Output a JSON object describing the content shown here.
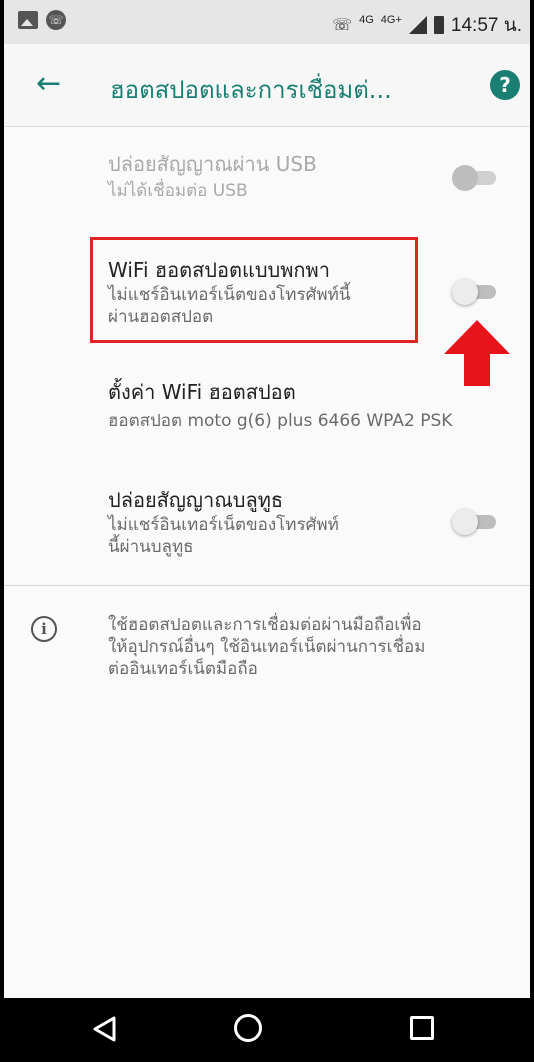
{
  "status_bar": {
    "network_small": "4G",
    "network": "4G+",
    "time": "14:57 น."
  },
  "toolbar": {
    "title": "ฮอตสปอตและการเชื่อมต่...",
    "help_label": "?"
  },
  "items": [
    {
      "title": "ปล่อยสัญญาณผ่าน USB",
      "subtitle": "ไม่ได้เชื่อมต่อ USB",
      "switch_on": false,
      "enabled": false
    },
    {
      "title": "WiFi ฮอตสปอตแบบพกพา",
      "subtitle": "ไม่แชร์อินเทอร์เน็ตของโทรศัพท์นี้\nผ่านฮอตสปอต",
      "switch_on": false,
      "enabled": true
    },
    {
      "title": "ตั้งค่า WiFi ฮอตสปอต",
      "subtitle": "ฮอตสปอต moto g(6) plus 6466 WPA2 PSK"
    },
    {
      "title": "ปล่อยสัญญาณบลูทูธ",
      "subtitle": "ไม่แชร์อินเทอร์เน็ตของโทรศัพท์\nนี้ผ่านบลูทูธ",
      "switch_on": false,
      "enabled": true
    }
  ],
  "info": {
    "icon_label": "i",
    "text": "ใช้ฮอตสปอตและการเชื่อมต่อผ่านมือถือเพื่อ\nให้อุปกรณ์อื่นๆ ใช้อินเทอร์เน็ตผ่านการเชื่อม\nต่ออินเทอร์เน็ตมือถือ"
  },
  "colors": {
    "accent": "#1a7f72",
    "highlight": "#e02424",
    "arrow": "#e8141c"
  }
}
